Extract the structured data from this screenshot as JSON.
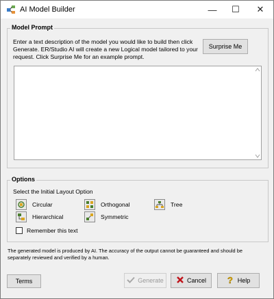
{
  "window": {
    "title": "AI Model Builder",
    "controls": {
      "minimize": "—",
      "maximize": "☐",
      "close": "✕"
    }
  },
  "prompt": {
    "section_label": "Model Prompt",
    "description": "Enter a text description of the model you would like to build then click Generate. ER/Studio AI will create a new Logical model tailored to your request. Click Surprise Me for an example prompt.",
    "surprise_button": "Surprise Me",
    "input_value": ""
  },
  "options": {
    "section_label": "Options",
    "caption": "Select the Initial Layout Option",
    "layouts": {
      "circular": "Circular",
      "orthogonal": "Orthogonal",
      "tree": "Tree",
      "hierarchical": "Hierarchical",
      "symmetric": "Symmetric"
    },
    "remember_label": "Remember this text",
    "remember_checked": false
  },
  "disclaimer": "The generated model is produced by AI. The accuracy of the output cannot be guaranteed and should be separately reviewed and verified by a human.",
  "buttons": {
    "terms": "Terms",
    "generate": "Generate",
    "cancel": "Cancel",
    "help": "Help"
  },
  "colors": {
    "window_bg": "#f0f0f0",
    "cancel_icon": "#c0141b",
    "help_icon": "#e8b400",
    "generate_icon": "#a8a8a8"
  }
}
